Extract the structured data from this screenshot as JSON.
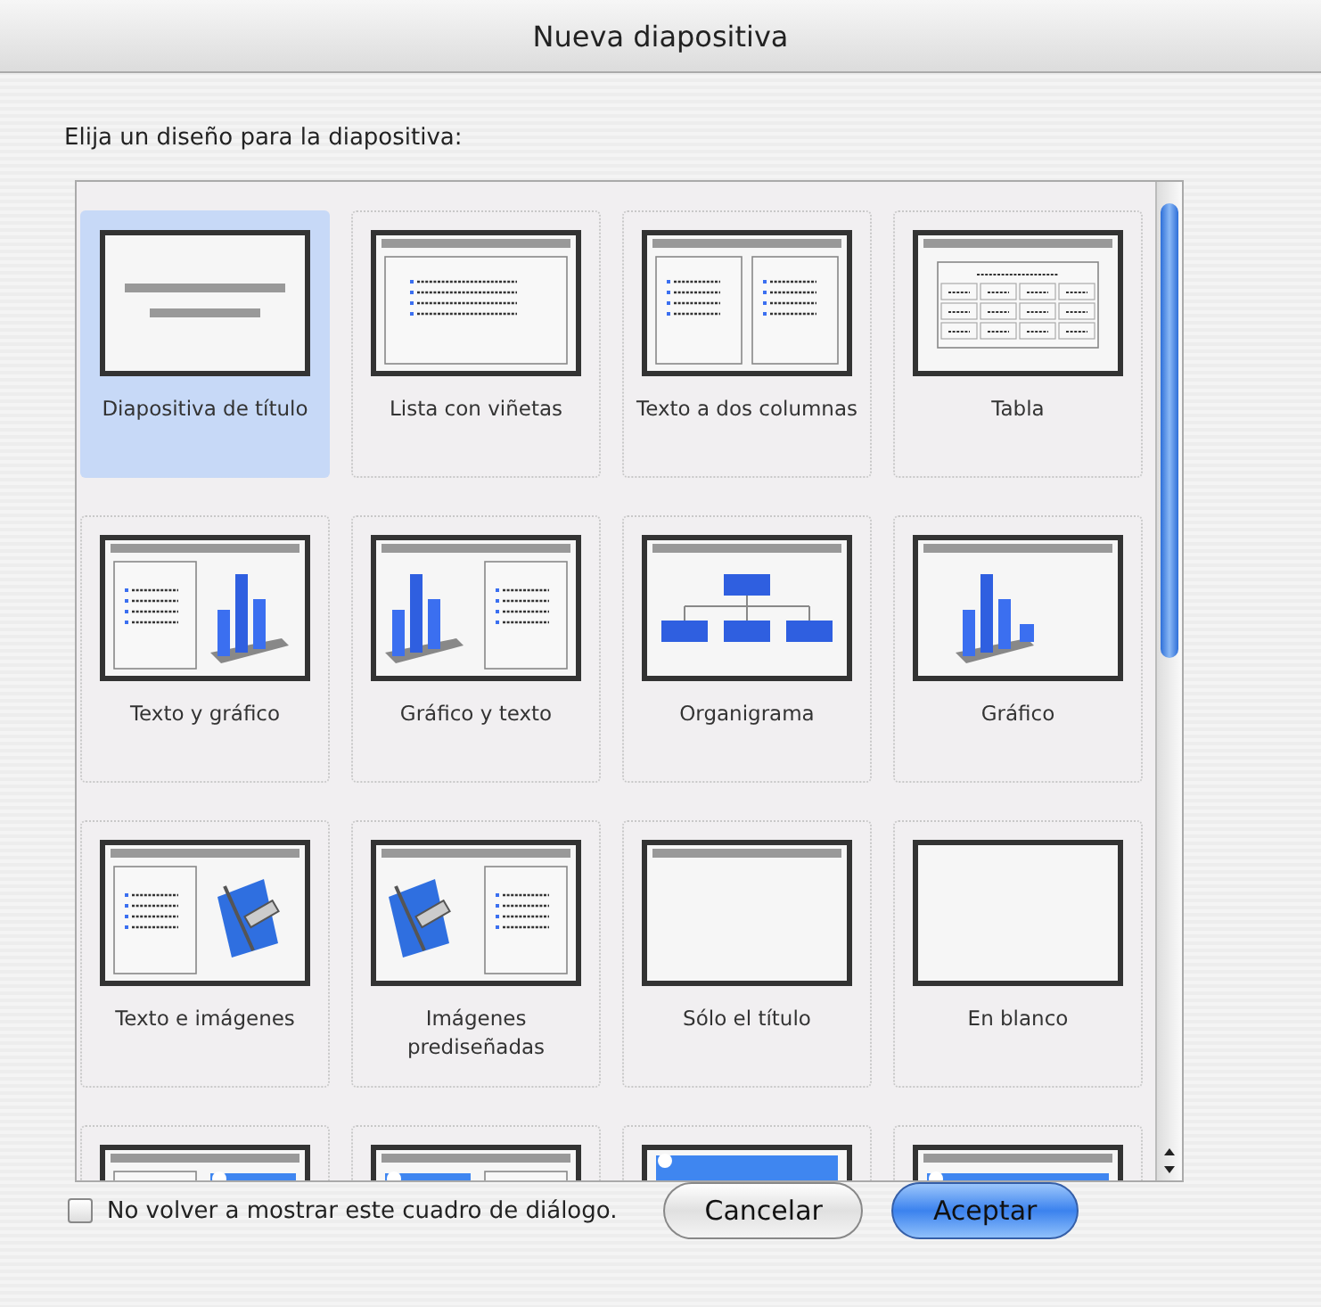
{
  "window": {
    "title": "Nueva diapositiva"
  },
  "prompt": "Elija un diseño para la diapositiva:",
  "layouts": [
    {
      "kind": "title",
      "label": "Diapositiva de título",
      "selected": true
    },
    {
      "kind": "bullets",
      "label": "Lista con viñetas",
      "selected": false
    },
    {
      "kind": "two-columns",
      "label": "Texto a dos columnas",
      "selected": false
    },
    {
      "kind": "table",
      "label": "Tabla",
      "selected": false
    },
    {
      "kind": "text-chart",
      "label": "Texto y gráfico",
      "selected": false
    },
    {
      "kind": "chart-text",
      "label": "Gráfico y texto",
      "selected": false
    },
    {
      "kind": "org-chart",
      "label": "Organigrama",
      "selected": false
    },
    {
      "kind": "chart",
      "label": "Gráfico",
      "selected": false
    },
    {
      "kind": "text-clipart",
      "label": "Texto e imágenes",
      "selected": false
    },
    {
      "kind": "clipart-text",
      "label": "Imágenes prediseñadas",
      "selected": false
    },
    {
      "kind": "title-only",
      "label": "Sólo el título",
      "selected": false
    },
    {
      "kind": "blank",
      "label": "En blanco",
      "selected": false
    },
    {
      "kind": "text-media",
      "selected": false
    },
    {
      "kind": "media-text",
      "selected": false
    },
    {
      "kind": "media",
      "selected": false
    },
    {
      "kind": "title-media",
      "selected": false
    }
  ],
  "dont_show_again": {
    "label": "No volver a mostrar este cuadro de diálogo.",
    "checked": false
  },
  "buttons": [
    {
      "label": "Cancelar",
      "kind": "cancel"
    },
    {
      "label": "Aceptar",
      "kind": "default"
    }
  ]
}
